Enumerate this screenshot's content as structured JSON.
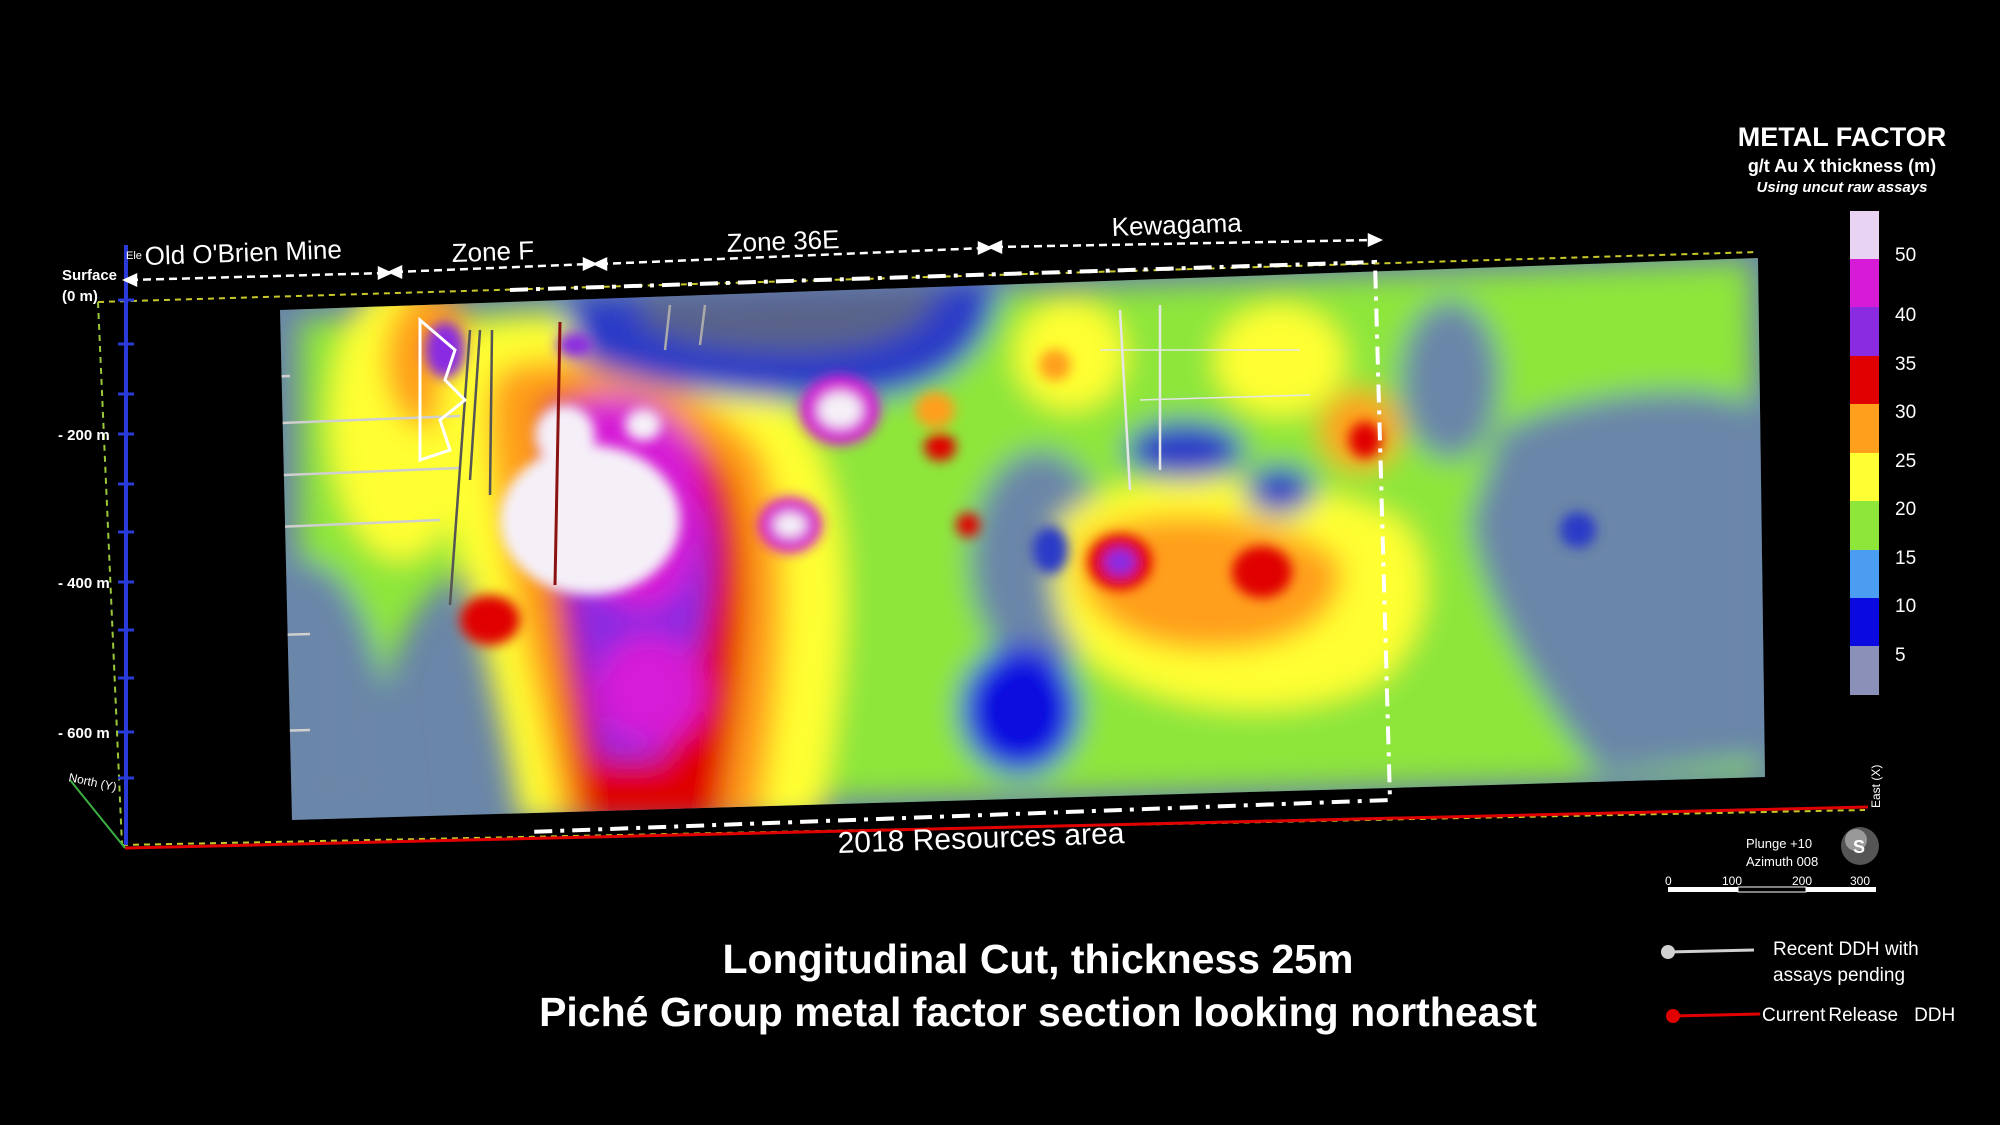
{
  "zones": [
    {
      "label": "Old O'Brien Mine"
    },
    {
      "label": "Zone F"
    },
    {
      "label": "Zone 36E"
    },
    {
      "label": "Kewagama"
    }
  ],
  "resources_label": "2018 Resources area",
  "depth_axis": {
    "surface_label": "Surface",
    "surface_sub": "(0 m)",
    "elev_label": "Ele",
    "ticks": [
      "- 200 m",
      "- 400 m",
      "- 600 m"
    ]
  },
  "north_label": "North (Y)",
  "east_label": "East (X)",
  "legend": {
    "title": "METAL FACTOR",
    "subtitle": "g/t Au X thickness (m)",
    "note": "Using uncut raw assays",
    "scale_labels": [
      "50",
      "40",
      "35",
      "30",
      "25",
      "20",
      "15",
      "10",
      "5"
    ],
    "colors": [
      "#e8d4f2",
      "#d61ad6",
      "#8a2be2",
      "#e00000",
      "#ff9f1c",
      "#ffff33",
      "#8ee63a",
      "#4a9df0",
      "#0a0ae0",
      "#8a90b8"
    ]
  },
  "orientation": {
    "plunge": "Plunge +10",
    "azimuth": "Azimuth 008",
    "compass_letter": "S"
  },
  "scale_bar": {
    "ticks": [
      "0",
      "100",
      "200",
      "300"
    ]
  },
  "ddh_legend": {
    "recent_line1": "Recent DDH with",
    "recent_line2": "assays pending",
    "current_a": "Current",
    "current_b": "Release",
    "current_c": "DDH",
    "recent_color": "#d0d0d0",
    "current_color": "#e00000"
  },
  "caption": {
    "line1": "Longitudinal Cut, thickness 25m",
    "line2": "Piché Group metal factor section looking northeast"
  }
}
